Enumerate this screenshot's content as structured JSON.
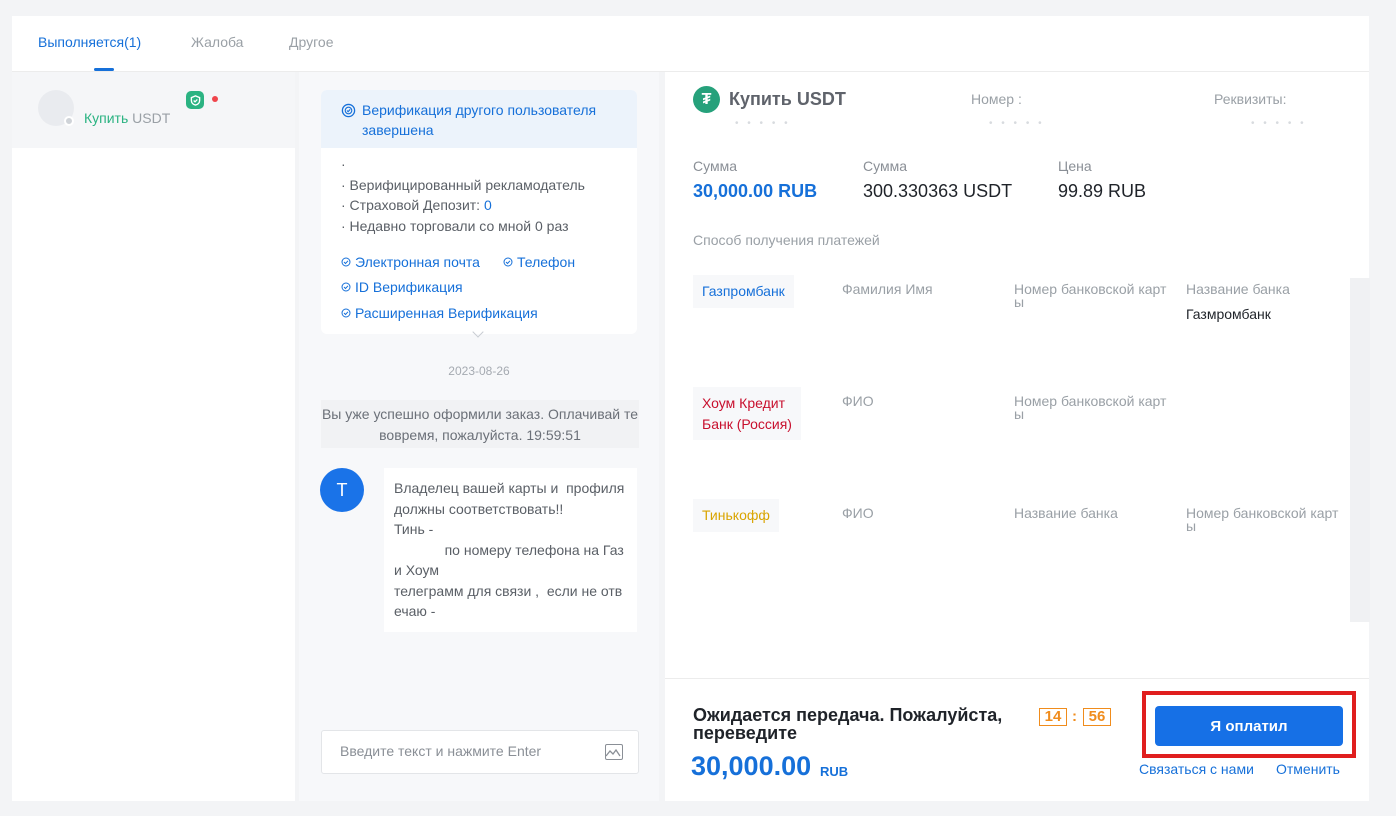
{
  "tabs": [
    {
      "label": "Выполняется(1)"
    },
    {
      "label": "Жалоба"
    },
    {
      "label": "Другое"
    }
  ],
  "order_list": {
    "item": {
      "buy_label": "Купить",
      "coin": "USDT"
    }
  },
  "verification": {
    "title": "Верификация другого пользователя завершена",
    "dot": "·",
    "items": [
      "· Верифицированный рекламодатель",
      "· Страховой Депозит: ",
      "· Недавно торговали со мной 0 раз"
    ],
    "deposit_value": "0",
    "links": [
      "Электронная почта",
      "Телефон",
      "ID Верификация",
      "Расширенная Верификация"
    ]
  },
  "chat": {
    "date": "2023-08-26",
    "system_message": "Вы уже успешно оформили заказ. Оплачивай те вовремя, пожалуйста. 19:59:51",
    "user_initial": "T",
    "message": "Владелец вашей карты и  профиля должны соответствовать!!\nТинь -\n             по номеру телефона на Газ и Хоум\nтелеграмм для связи ,  если не отвечаю -",
    "input_placeholder": "Введите текст и нажмите Enter"
  },
  "order": {
    "title": "Купить USDT",
    "coin_symbol": "₮",
    "number_label": "Номер :",
    "requisites_label": "Реквизиты:",
    "masked": "• • • • •",
    "amount_label": "Сумма",
    "amount_value": "30,000.00 RUB",
    "quantity_label": "Сумма",
    "quantity_value": "300.330363 USDT",
    "price_label": "Цена",
    "price_value": "99.89 RUB"
  },
  "payment_methods": {
    "title": "Способ получения платежей",
    "methods": [
      {
        "bank": "Газпромбанк",
        "bank_color": "#1670d9",
        "col1": "Фамилия Имя",
        "col2": "Номер банковской карт\nы",
        "col3": "Название банка",
        "col3_value": "Газмромбанк"
      },
      {
        "bank": "Хоум Кредит\nБанк (Россия)",
        "bank_color": "#c8102e",
        "col1": "ФИО",
        "col2": "Номер банковской карт\nы",
        "col3": "",
        "col3_value": ""
      },
      {
        "bank": "Тинькофф",
        "bank_color": "#d9a400",
        "col1": "ФИО",
        "col2": "Название банка",
        "col3": "Номер банковской карт\nы",
        "col3_value": ""
      }
    ]
  },
  "footer": {
    "status": "Ожидается передача. Пожалуйста, переведите",
    "amount": "30,000.00",
    "currency": "RUB",
    "timer_minutes": "14",
    "timer_seconds": "56",
    "timer_sep": ":",
    "paid_button": "Я оплатил",
    "contact_link": "Связаться с нами",
    "cancel_link": "Отменить",
    "highlight_color": "#e01e1e"
  }
}
